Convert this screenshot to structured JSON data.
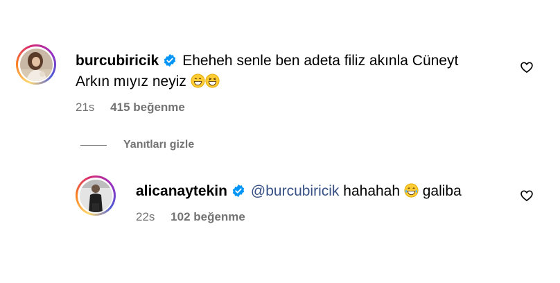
{
  "comment": {
    "username": "burcubiricik",
    "text_line1": "Eheheh senle ben adeta filiz akınla Cüneyt",
    "text_line2": "Arkın mıyız neyiz",
    "time": "21s",
    "likes": "415 beğenme",
    "icons": [
      "verified-badge-icon",
      "grinning-emoji-icon",
      "squinting-laughing-emoji-icon",
      "heart-outline-icon"
    ]
  },
  "replies_toggle": {
    "label": "Yanıtları gizle"
  },
  "reply": {
    "username": "alicanaytekin",
    "mention": "@burcubiricik",
    "text_before_emoji": "hahahah",
    "text_after_emoji": "galiba",
    "time": "22s",
    "likes": "102 beğenme",
    "icons": [
      "verified-badge-icon",
      "tears-of-joy-emoji-icon",
      "heart-outline-icon"
    ]
  },
  "colors": {
    "verified": "#0095F6",
    "mention": "#385185",
    "meta_text": "#737373"
  }
}
